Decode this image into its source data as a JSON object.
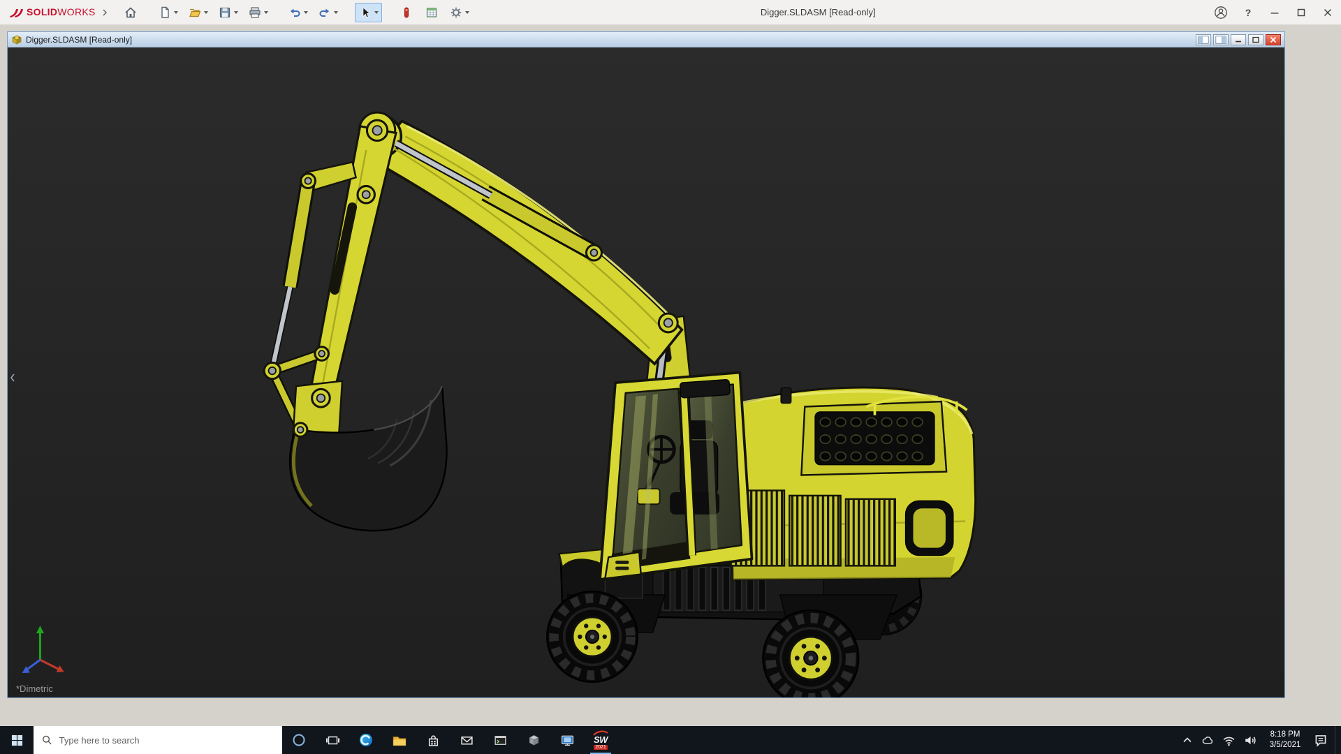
{
  "colors": {
    "excavator_yellow": "#d6d632",
    "viewport_background": "#242424",
    "taskbar_background": "#11151c",
    "doc_titlebar_top": "#e3edf8",
    "doc_titlebar_bottom": "#b9cfe6",
    "close_button_red": "#d8442c",
    "brand_red": "#c8102e",
    "selected_tool_highlight": "#cfe3f7",
    "taskbar_active_underline": "#76b9ed"
  },
  "brand": {
    "bold": "SOLID",
    "light": "WORKS"
  },
  "titlebar": {
    "title": "Digger.SLDASM [Read-only]",
    "help_glyph": "?"
  },
  "doc_window": {
    "title": "Digger.SLDASM [Read-only]"
  },
  "viewport": {
    "orientation_label": "*Dimetric"
  },
  "taskbar": {
    "search_placeholder": "Type here to search",
    "clock_time": "8:18 PM",
    "clock_date": "3/5/2021",
    "sw_text": "SW",
    "sw_year": "2021"
  }
}
